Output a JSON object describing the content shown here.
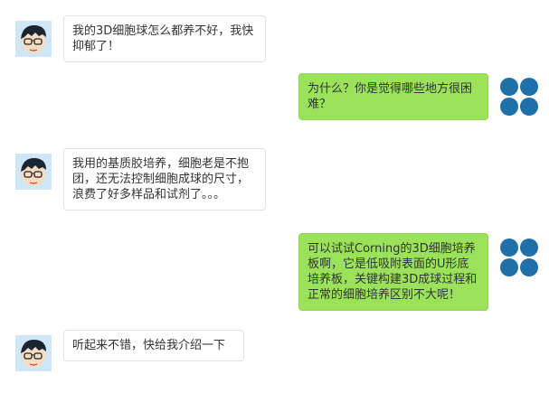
{
  "conversation": {
    "messages": [
      {
        "side": "left",
        "text": "我的3D细胞球怎么都养不好，我快抑郁了！",
        "avatar_icon": "cartoon-boy-avatar-icon"
      },
      {
        "side": "right",
        "text": "为什么？你是觉得哪些地方很困难？",
        "avatar_icon": "four-blue-dots-logo-icon"
      },
      {
        "side": "left",
        "text": "我用的基质胶培养，细胞老是不抱团，还无法控制细胞成球的尺寸，浪费了好多样品和试剂了。。。",
        "avatar_icon": "cartoon-boy-avatar-icon"
      },
      {
        "side": "right",
        "text": "可以试试Corning的3D细胞培养板啊，它是低吸附表面的U形底培养板，关键构建3D成球过程和正常的细胞培养区别不大呢！",
        "avatar_icon": "four-blue-dots-logo-icon"
      },
      {
        "side": "left",
        "text": "听起来不错，快给我介绍一下",
        "avatar_icon": "cartoon-boy-avatar-icon"
      }
    ]
  },
  "colors": {
    "left_bubble": "#ffffff",
    "right_bubble": "#99e25a",
    "logo_dots": "#1f6fa8"
  }
}
